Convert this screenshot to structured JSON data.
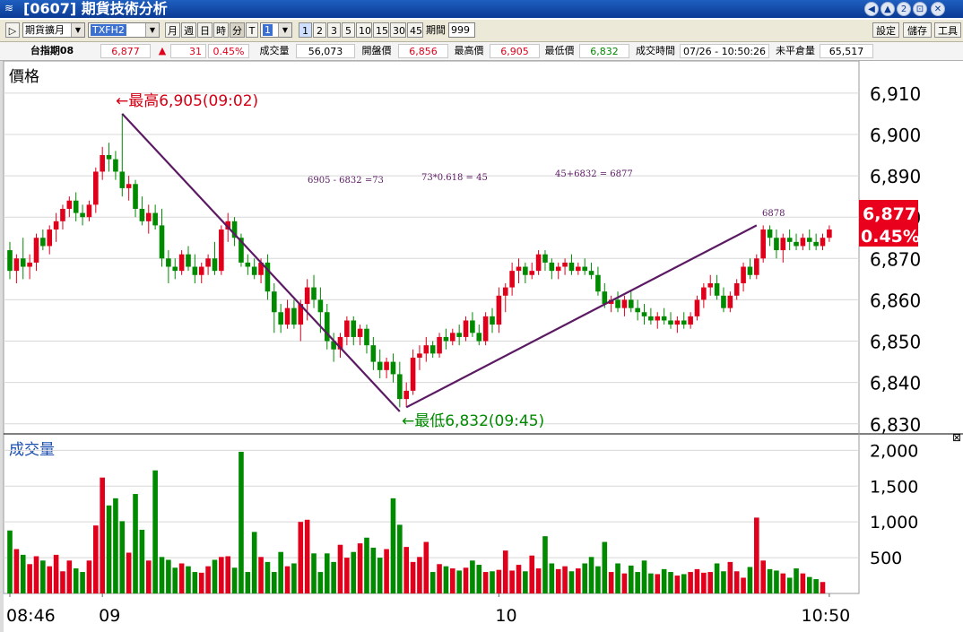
{
  "window": {
    "title": "[0607] 期貨技術分析",
    "buttons": [
      "◀",
      "▲",
      "2",
      "⊡",
      "✕"
    ]
  },
  "toolbar": {
    "play_icon": "▷",
    "product_select": "期貨擴月",
    "symbol_select": "TXFH2",
    "periods": [
      "月",
      "週",
      "日",
      "時",
      "分",
      "T"
    ],
    "active_period": "分",
    "interval_select": "1",
    "minute_buttons": [
      "1",
      "2",
      "3",
      "5",
      "10",
      "15",
      "30",
      "45"
    ],
    "active_minute": "1",
    "count_label": "期間",
    "count_value": "999",
    "right_buttons": [
      "設定",
      "儲存",
      "工具"
    ]
  },
  "quote": {
    "name": "台指期08",
    "price": "6,877",
    "change_arrow": "▲",
    "change": "31",
    "change_pct": "0.45%",
    "volume_label": "成交量",
    "volume": "56,073",
    "open_label": "開盤價",
    "open": "6,856",
    "high_label": "最高價",
    "high": "6,905",
    "low_label": "最低價",
    "low": "6,832",
    "time_label": "成交時間",
    "time": "07/26 - 10:50:26",
    "oi_label": "未平倉量",
    "oi": "65,517"
  },
  "chart_data": {
    "type": "candlestick",
    "price_panel_title": "價格",
    "volume_panel_title": "成交量",
    "price_ticks": [
      "6,830",
      "6,840",
      "6,850",
      "6,860",
      "6,870",
      "6,880",
      "6,890",
      "6,900",
      "6,910"
    ],
    "price_tick_values": [
      6830,
      6840,
      6850,
      6860,
      6870,
      6880,
      6890,
      6900,
      6910
    ],
    "price_ylim": [
      6828,
      6913
    ],
    "volume_ticks": [
      "500",
      "1,000",
      "1,500",
      "2,000"
    ],
    "volume_tick_values": [
      500,
      1000,
      1500,
      2000
    ],
    "volume_ylim": [
      0,
      2180
    ],
    "x_labels": [
      {
        "label": "08:46",
        "index": 0
      },
      {
        "label": "09",
        "index": 14
      },
      {
        "label": "10",
        "index": 74
      },
      {
        "label": "10:50",
        "index": 124
      }
    ],
    "current_price": "6,877",
    "current_pct": "0.45%",
    "current_value": 6877,
    "annotations": {
      "high": "←最高6,905(09:02)",
      "low": "←最低6,832(09:45)",
      "calc1": "6905 - 6832  =73",
      "calc2": "73*0.618 = 45",
      "calc3": "45+6832 = 6877",
      "target": "6878"
    },
    "trendlines": [
      {
        "from": {
          "index": 17,
          "value": 6905
        },
        "to": {
          "index": 59,
          "value": 6833
        }
      },
      {
        "from": {
          "index": 60,
          "value": 6834
        },
        "to": {
          "index": 113,
          "value": 6878
        }
      }
    ],
    "ohlc": [
      [
        6872,
        6874,
        6865,
        6867
      ],
      [
        6867,
        6871,
        6864,
        6870
      ],
      [
        6870,
        6875,
        6865,
        6868
      ],
      [
        6868,
        6871,
        6865,
        6869
      ],
      [
        6869,
        6876,
        6867,
        6875
      ],
      [
        6875,
        6877,
        6872,
        6873
      ],
      [
        6873,
        6878,
        6871,
        6877
      ],
      [
        6877,
        6881,
        6874,
        6879
      ],
      [
        6879,
        6883,
        6877,
        6882
      ],
      [
        6882,
        6885,
        6880,
        6884
      ],
      [
        6884,
        6886,
        6879,
        6881
      ],
      [
        6881,
        6883,
        6878,
        6880
      ],
      [
        6880,
        6884,
        6879,
        6883
      ],
      [
        6883,
        6892,
        6881,
        6891
      ],
      [
        6891,
        6897,
        6889,
        6895
      ],
      [
        6895,
        6898,
        6891,
        6894
      ],
      [
        6894,
        6896,
        6889,
        6891
      ],
      [
        6891,
        6905,
        6885,
        6887
      ],
      [
        6887,
        6890,
        6884,
        6888
      ],
      [
        6888,
        6889,
        6880,
        6882
      ],
      [
        6882,
        6885,
        6878,
        6879
      ],
      [
        6879,
        6883,
        6876,
        6881
      ],
      [
        6881,
        6883,
        6877,
        6878
      ],
      [
        6878,
        6882,
        6868,
        6870
      ],
      [
        6870,
        6872,
        6864,
        6868
      ],
      [
        6868,
        6870,
        6865,
        6867
      ],
      [
        6867,
        6872,
        6866,
        6871
      ],
      [
        6871,
        6873,
        6867,
        6868
      ],
      [
        6868,
        6871,
        6864,
        6866
      ],
      [
        6866,
        6869,
        6864,
        6868
      ],
      [
        6868,
        6871,
        6866,
        6870
      ],
      [
        6870,
        6874,
        6866,
        6867
      ],
      [
        6867,
        6878,
        6866,
        6877
      ],
      [
        6877,
        6881,
        6874,
        6879
      ],
      [
        6879,
        6880,
        6873,
        6875
      ],
      [
        6875,
        6876,
        6868,
        6869
      ],
      [
        6869,
        6871,
        6866,
        6868
      ],
      [
        6868,
        6870,
        6865,
        6866
      ],
      [
        6866,
        6870,
        6864,
        6869
      ],
      [
        6869,
        6871,
        6860,
        6862
      ],
      [
        6862,
        6864,
        6852,
        6857
      ],
      [
        6857,
        6859,
        6852,
        6854
      ],
      [
        6854,
        6860,
        6853,
        6858
      ],
      [
        6858,
        6860,
        6853,
        6854
      ],
      [
        6854,
        6860,
        6850,
        6859
      ],
      [
        6859,
        6865,
        6855,
        6863
      ],
      [
        6863,
        6866,
        6858,
        6860
      ],
      [
        6860,
        6863,
        6852,
        6857
      ],
      [
        6857,
        6859,
        6848,
        6850
      ],
      [
        6850,
        6852,
        6845,
        6848
      ],
      [
        6848,
        6852,
        6846,
        6851
      ],
      [
        6851,
        6856,
        6849,
        6855
      ],
      [
        6855,
        6856,
        6849,
        6851
      ],
      [
        6851,
        6854,
        6849,
        6853
      ],
      [
        6853,
        6854,
        6847,
        6849
      ],
      [
        6849,
        6851,
        6843,
        6845
      ],
      [
        6845,
        6848,
        6841,
        6843
      ],
      [
        6843,
        6846,
        6841,
        6845
      ],
      [
        6845,
        6847,
        6840,
        6842
      ],
      [
        6842,
        6845,
        6834,
        6836
      ],
      [
        6836,
        6840,
        6834,
        6838
      ],
      [
        6838,
        6848,
        6837,
        6846
      ],
      [
        6846,
        6849,
        6843,
        6847
      ],
      [
        6847,
        6851,
        6845,
        6849
      ],
      [
        6849,
        6850,
        6846,
        6847
      ],
      [
        6847,
        6852,
        6846,
        6851
      ],
      [
        6851,
        6853,
        6848,
        6850
      ],
      [
        6850,
        6853,
        6849,
        6852
      ],
      [
        6852,
        6854,
        6849,
        6851
      ],
      [
        6851,
        6856,
        6850,
        6855
      ],
      [
        6855,
        6857,
        6851,
        6852
      ],
      [
        6852,
        6854,
        6849,
        6850
      ],
      [
        6850,
        6857,
        6849,
        6856
      ],
      [
        6856,
        6858,
        6852,
        6854
      ],
      [
        6854,
        6863,
        6852,
        6861
      ],
      [
        6861,
        6864,
        6857,
        6863
      ],
      [
        6863,
        6869,
        6861,
        6867
      ],
      [
        6867,
        6870,
        6864,
        6868
      ],
      [
        6868,
        6869,
        6864,
        6866
      ],
      [
        6866,
        6869,
        6865,
        6867
      ],
      [
        6867,
        6872,
        6866,
        6871
      ],
      [
        6871,
        6872,
        6867,
        6869
      ],
      [
        6869,
        6870,
        6865,
        6867
      ],
      [
        6867,
        6869,
        6865,
        6868
      ],
      [
        6868,
        6870,
        6866,
        6869
      ],
      [
        6869,
        6871,
        6866,
        6867
      ],
      [
        6867,
        6869,
        6866,
        6868
      ],
      [
        6868,
        6870,
        6866,
        6867
      ],
      [
        6867,
        6869,
        6865,
        6866
      ],
      [
        6866,
        6868,
        6861,
        6862
      ],
      [
        6862,
        6864,
        6858,
        6859
      ],
      [
        6859,
        6861,
        6857,
        6860
      ],
      [
        6860,
        6862,
        6857,
        6858
      ],
      [
        6858,
        6861,
        6856,
        6860
      ],
      [
        6860,
        6862,
        6857,
        6858
      ],
      [
        6858,
        6860,
        6855,
        6857
      ],
      [
        6857,
        6859,
        6854,
        6856
      ],
      [
        6856,
        6858,
        6854,
        6855
      ],
      [
        6855,
        6857,
        6853,
        6856
      ],
      [
        6856,
        6858,
        6854,
        6855
      ],
      [
        6855,
        6857,
        6853,
        6854
      ],
      [
        6854,
        6856,
        6852,
        6855
      ],
      [
        6855,
        6857,
        6853,
        6854
      ],
      [
        6854,
        6857,
        6853,
        6856
      ],
      [
        6856,
        6861,
        6855,
        6860
      ],
      [
        6860,
        6864,
        6858,
        6863
      ],
      [
        6863,
        6866,
        6861,
        6864
      ],
      [
        6864,
        6866,
        6860,
        6861
      ],
      [
        6861,
        6863,
        6857,
        6858
      ],
      [
        6858,
        6862,
        6857,
        6861
      ],
      [
        6861,
        6865,
        6860,
        6864
      ],
      [
        6864,
        6869,
        6862,
        6868
      ],
      [
        6868,
        6870,
        6865,
        6866
      ],
      [
        6866,
        6871,
        6865,
        6870
      ],
      [
        6870,
        6878,
        6869,
        6877
      ],
      [
        6877,
        6878,
        6873,
        6875
      ],
      [
        6875,
        6877,
        6870,
        6872
      ],
      [
        6872,
        6876,
        6869,
        6875
      ],
      [
        6875,
        6877,
        6872,
        6874
      ],
      [
        6874,
        6876,
        6872,
        6873
      ],
      [
        6873,
        6876,
        6872,
        6875
      ],
      [
        6875,
        6877,
        6872,
        6874
      ],
      [
        6874,
        6876,
        6872,
        6873
      ],
      [
        6873,
        6876,
        6872,
        6875
      ],
      [
        6875,
        6878,
        6874,
        6877
      ]
    ],
    "volume": [
      880,
      620,
      540,
      410,
      520,
      460,
      380,
      540,
      310,
      460,
      350,
      300,
      460,
      950,
      1620,
      1230,
      1330,
      1010,
      570,
      1390,
      890,
      460,
      1720,
      510,
      470,
      360,
      420,
      380,
      300,
      290,
      380,
      470,
      510,
      520,
      360,
      1980,
      300,
      860,
      510,
      440,
      300,
      580,
      380,
      420,
      1000,
      1030,
      560,
      300,
      560,
      440,
      680,
      500,
      580,
      700,
      780,
      640,
      500,
      620,
      1330,
      960,
      650,
      440,
      510,
      720,
      300,
      410,
      380,
      350,
      320,
      360,
      460,
      400,
      300,
      310,
      330,
      600,
      320,
      400,
      310,
      530,
      350,
      800,
      420,
      340,
      380,
      310,
      350,
      420,
      510,
      380,
      720,
      300,
      420,
      280,
      390,
      300,
      460,
      280,
      270,
      340,
      300,
      250,
      270,
      300,
      340,
      290,
      300,
      420,
      310,
      440,
      310,
      220,
      370,
      1060,
      460,
      340,
      320,
      280,
      220,
      350,
      280,
      230,
      200,
      160
    ],
    "up_color": "#e0001b",
    "down_color": "#008a00",
    "trend_color": "#5b1a63"
  }
}
